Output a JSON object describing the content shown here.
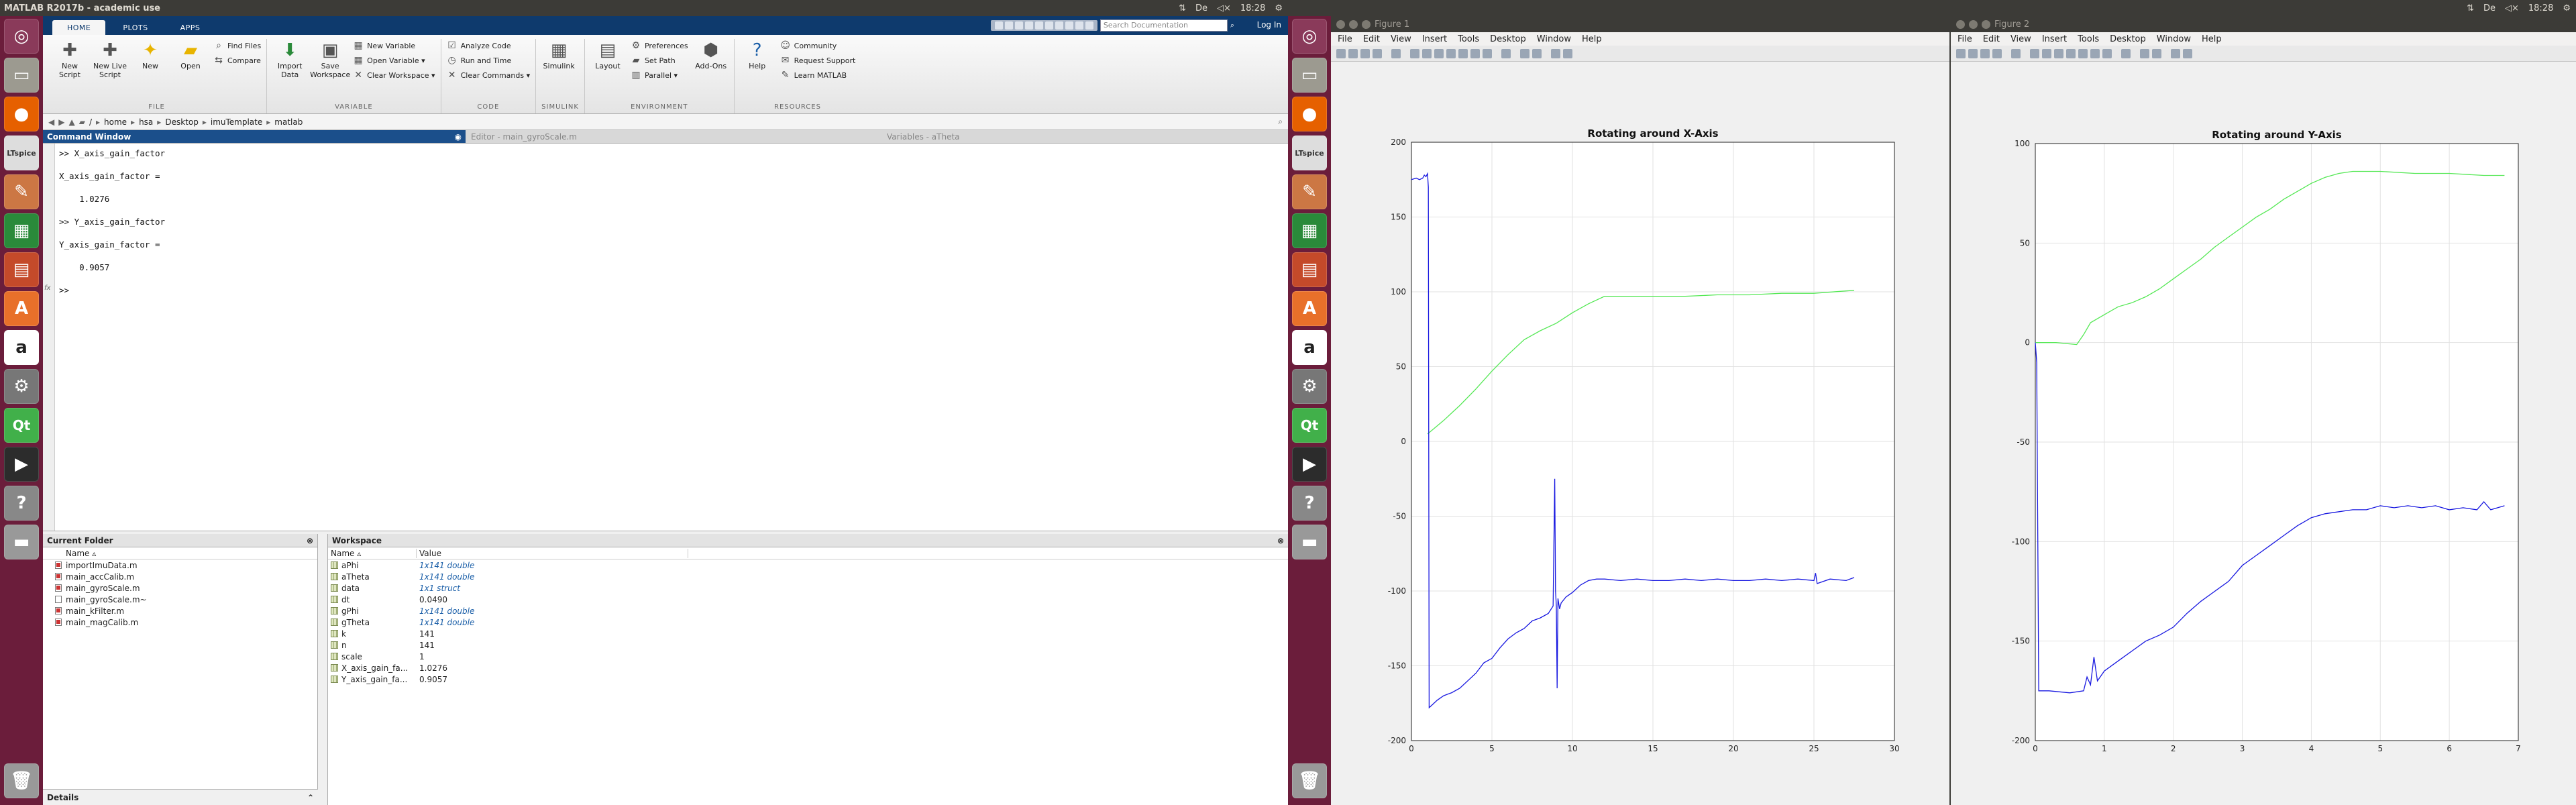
{
  "topbar_left": {
    "title": "MATLAB R2017b - academic use",
    "time": "18:28",
    "indicators": [
      "⇅",
      "De",
      "◁×"
    ]
  },
  "topbar_right": {
    "time": "18:28",
    "indicators": [
      "⇅",
      "De",
      "◁×"
    ]
  },
  "launcher": {
    "apps": [
      "dash",
      "files",
      "firefox",
      "ltspice",
      "tools",
      "calc",
      "impress",
      "software",
      "amazon",
      "settings",
      "qt",
      "terminal",
      "help",
      "drive",
      "trash"
    ],
    "labels": {
      "ltspice": "LTspice",
      "qt": "Qt",
      "software": "A",
      "amazon": "a"
    }
  },
  "matlab": {
    "tabs": [
      "HOME",
      "PLOTS",
      "APPS"
    ],
    "search_placeholder": "Search Documentation",
    "login": "Log In",
    "ribbon": {
      "file": {
        "label": "FILE",
        "new_script": "New Script",
        "new_live_script": "New Live Script",
        "new": "New",
        "open": "Open",
        "find_files": "Find Files",
        "compare": "Compare"
      },
      "variable": {
        "label": "VARIABLE",
        "import_data": "Import Data",
        "save_workspace": "Save Workspace",
        "new_variable": "New Variable",
        "open_variable": "Open Variable ▾",
        "clear_workspace": "Clear Workspace ▾"
      },
      "code": {
        "label": "CODE",
        "analyze_code": "Analyze Code",
        "run_and_time": "Run and Time",
        "clear_commands": "Clear Commands ▾"
      },
      "simulink": {
        "label": "SIMULINK",
        "simulink": "Simulink"
      },
      "environment": {
        "label": "ENVIRONMENT",
        "layout": "Layout",
        "preferences": "Preferences",
        "set_path": "Set Path",
        "parallel": "Parallel ▾",
        "add_ons": "Add-Ons"
      },
      "resources": {
        "label": "RESOURCES",
        "help": "Help",
        "community": "Community",
        "request_support": "Request Support",
        "learn_matlab": "Learn MATLAB"
      }
    },
    "path": [
      "/",
      "home",
      "hsa",
      "Desktop",
      "imuTemplate",
      "matlab"
    ],
    "windows": {
      "command": "Command Window",
      "editor": "Editor - main_gyroScale.m",
      "variables": "Variables - aTheta"
    },
    "command_lines": [
      ">> X_axis_gain_factor",
      "",
      "X_axis_gain_factor =",
      "",
      "    1.0276",
      "",
      ">> Y_axis_gain_factor",
      "",
      "Y_axis_gain_factor =",
      "",
      "    0.9057",
      "",
      ">>"
    ],
    "prompt_marker": "fx",
    "current_folder": {
      "title": "Current Folder",
      "col_name": "Name ▵",
      "files": [
        "importImuData.m",
        "main_accCalib.m",
        "main_gyroScale.m",
        "main_gyroScale.m~",
        "main_kFilter.m",
        "main_magCalib.m"
      ]
    },
    "workspace": {
      "title": "Workspace",
      "col_name": "Name ▵",
      "col_value": "Value",
      "rows": [
        {
          "name": "aPhi",
          "value": "1x141 double",
          "link": true
        },
        {
          "name": "aTheta",
          "value": "1x141 double",
          "link": true
        },
        {
          "name": "data",
          "value": "1x1 struct",
          "link": true
        },
        {
          "name": "dt",
          "value": "0.0490",
          "link": false
        },
        {
          "name": "gPhi",
          "value": "1x141 double",
          "link": true
        },
        {
          "name": "gTheta",
          "value": "1x141 double",
          "link": true
        },
        {
          "name": "k",
          "value": "141",
          "link": false
        },
        {
          "name": "n",
          "value": "141",
          "link": false
        },
        {
          "name": "scale",
          "value": "1",
          "link": false
        },
        {
          "name": "X_axis_gain_fa...",
          "value": "1.0276",
          "link": false
        },
        {
          "name": "Y_axis_gain_fa...",
          "value": "0.9057",
          "link": false
        }
      ]
    },
    "details": "Details"
  },
  "figures": [
    {
      "window_title": "Figure 1",
      "menu": [
        "File",
        "Edit",
        "View",
        "Insert",
        "Tools",
        "Desktop",
        "Window",
        "Help"
      ]
    },
    {
      "window_title": "Figure 2",
      "menu": [
        "File",
        "Edit",
        "View",
        "Insert",
        "Tools",
        "Desktop",
        "Window",
        "Help"
      ]
    }
  ],
  "colors": {
    "series_green": "#55e855",
    "series_blue": "#1818e0",
    "matlab_blue": "#0e3a6d",
    "launcher": "#6b1d3b"
  },
  "chart_data": [
    {
      "type": "line",
      "title": "Rotating around X-Axis",
      "xlim": [
        0,
        30
      ],
      "ylim": [
        -200,
        200
      ],
      "xticks": [
        0,
        5,
        10,
        15,
        20,
        25,
        30
      ],
      "yticks": [
        -200,
        -150,
        -100,
        -50,
        0,
        50,
        100,
        150,
        200
      ],
      "grid": true,
      "series": [
        {
          "color": "#55e855",
          "x": [
            1,
            2,
            3,
            4,
            5,
            6,
            7,
            8,
            9,
            10,
            11,
            12,
            13,
            15,
            17,
            19,
            21,
            23,
            25,
            27.5
          ],
          "y": [
            5,
            14,
            24,
            35,
            47,
            58,
            68,
            74,
            79,
            86,
            92,
            97,
            97,
            97,
            97,
            98,
            98,
            99,
            99,
            101
          ]
        },
        {
          "color": "#1818e0",
          "x": [
            0,
            0.3,
            0.5,
            0.7,
            0.8,
            0.9,
            1,
            1.05,
            1.1,
            1.3,
            1.6,
            2,
            2.5,
            3,
            3.5,
            4,
            4.5,
            5,
            5.5,
            6,
            6.5,
            7,
            7.5,
            8,
            8.5,
            8.8,
            8.9,
            8.95,
            9,
            9.05,
            9.1,
            9.2,
            9.3,
            9.6,
            10,
            10.5,
            11,
            11.5,
            12,
            13,
            14,
            15,
            16,
            17,
            18,
            19,
            20,
            21,
            22,
            23,
            24,
            25,
            25.1,
            25.2,
            26,
            27,
            27.5
          ],
          "y": [
            175,
            176,
            175,
            176,
            178,
            177,
            179,
            170,
            -178,
            -176,
            -173,
            -170,
            -168,
            -165,
            -160,
            -155,
            -148,
            -145,
            -138,
            -132,
            -128,
            -125,
            -120,
            -118,
            -115,
            -110,
            -25,
            -100,
            -110,
            -165,
            -105,
            -112,
            -108,
            -104,
            -101,
            -96,
            -93,
            -92,
            -92,
            -93,
            -92,
            -93,
            -93,
            -92,
            -93,
            -92,
            -93,
            -93,
            -92,
            -93,
            -92,
            -93,
            -88,
            -95,
            -92,
            -93,
            -91
          ]
        }
      ]
    },
    {
      "type": "line",
      "title": "Rotating around Y-Axis",
      "xlim": [
        0,
        7
      ],
      "ylim": [
        -200,
        100
      ],
      "xticks": [
        0,
        1,
        2,
        3,
        4,
        5,
        6,
        7
      ],
      "yticks": [
        -200,
        -150,
        -100,
        -50,
        0,
        50,
        100
      ],
      "grid": true,
      "series": [
        {
          "color": "#55e855",
          "x": [
            0,
            0.3,
            0.6,
            0.7,
            0.8,
            1,
            1.2,
            1.4,
            1.6,
            1.8,
            2,
            2.2,
            2.4,
            2.6,
            2.8,
            3,
            3.2,
            3.4,
            3.6,
            3.8,
            4,
            4.2,
            4.4,
            4.6,
            4.8,
            5,
            5.5,
            6,
            6.5,
            6.8
          ],
          "y": [
            0,
            0,
            -1,
            4,
            10,
            14,
            18,
            20,
            23,
            27,
            32,
            37,
            42,
            48,
            53,
            58,
            63,
            67,
            72,
            76,
            80,
            83,
            85,
            86,
            86,
            86,
            85,
            85,
            84,
            84
          ]
        },
        {
          "color": "#1818e0",
          "x": [
            0,
            0.02,
            0.05,
            0.2,
            0.5,
            0.7,
            0.75,
            0.8,
            0.85,
            0.9,
            1,
            1.2,
            1.4,
            1.6,
            1.8,
            2,
            2.2,
            2.4,
            2.6,
            2.8,
            3,
            3.2,
            3.4,
            3.6,
            3.8,
            4,
            4.2,
            4.4,
            4.6,
            4.8,
            5,
            5.2,
            5.4,
            5.6,
            5.8,
            6,
            6.2,
            6.4,
            6.5,
            6.6,
            6.8
          ],
          "y": [
            0,
            -10,
            -175,
            -175,
            -176,
            -175,
            -168,
            -172,
            -158,
            -170,
            -165,
            -160,
            -155,
            -150,
            -147,
            -143,
            -136,
            -130,
            -125,
            -120,
            -112,
            -107,
            -102,
            -97,
            -92,
            -88,
            -86,
            -85,
            -84,
            -84,
            -82,
            -83,
            -82,
            -83,
            -82,
            -84,
            -83,
            -84,
            -80,
            -84,
            -82
          ]
        }
      ]
    }
  ]
}
